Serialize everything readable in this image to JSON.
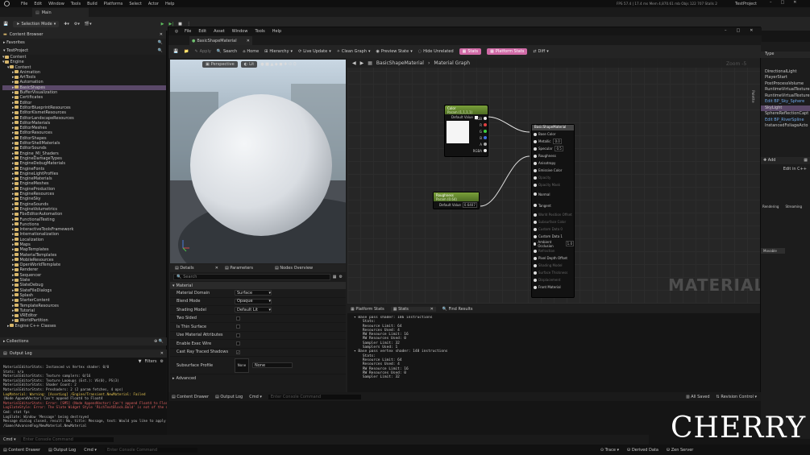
{
  "top": {
    "menu": [
      "File",
      "Edit",
      "Window",
      "Tools",
      "Build",
      "Platforms",
      "Select",
      "Actor",
      "Help"
    ],
    "stats": "FPS 57.4 | 17.4 ms  Mem 4,870.61 mb  Objs 122 707  Stalls 2",
    "project": "TestProject",
    "map_tab": "Main",
    "selection_mode": "Selection Mode"
  },
  "cb": {
    "title": "Content Browser",
    "favorites": "Favorites",
    "project": "TestProject",
    "items": [
      "Content",
      "Engine",
      "Content",
      "Animation",
      "ArtTools",
      "Automation",
      "BasicShapes",
      "BufferVisualization",
      "Certificates",
      "Editor",
      "EditorBlueprintResources",
      "EditorKismetResources",
      "EditorLandscapeResources",
      "EditorMaterials",
      "EditorMeshes",
      "EditorResources",
      "EditorShapes",
      "EditorShellMaterials",
      "EditorSounds",
      "Engine_MI_Shaders",
      "EngineDamageTypes",
      "EngineDebugMaterials",
      "EngineFonts",
      "EngineLightProfiles",
      "EngineMaterials",
      "EngineMeshes",
      "EngineProduction",
      "EngineResources",
      "EngineSky",
      "EngineSounds",
      "EngineVolumetrics",
      "FbxEditorAutomation",
      "FunctionalTesting",
      "Functions",
      "InteractiveToolsFramework",
      "Internationalization",
      "Localization",
      "Maps",
      "MapTemplates",
      "MaterialTemplates",
      "MobileResources",
      "OpenWorldTemplate",
      "Renderer",
      "Sequencer",
      "Slate",
      "SlateDebug",
      "SlateFileDialogs",
      "Splash",
      "StarterContent",
      "TemplateResources",
      "Tutorial",
      "VREditor",
      "WorldPartition",
      "Engine C++ Classes"
    ],
    "collections": "Collections"
  },
  "ol": {
    "title": "Output Log",
    "filters": "Filters",
    "lines": [
      "MaterialEditorStats: Instanced vs Vertex shader: 0/0",
      "Stats: n/a",
      "MaterialEditorStats: Texture samplers: 0/16",
      "MaterialEditorStats: Texture Lookups (Est.): VS(0), PS(3)",
      "MaterialEditorStats: Shader Count: 2",
      "MaterialEditorStats: Preshaders: 2  (2 param fetches, 4 ops)",
      "LogMaterial: Warning: [AssetLog] /Engine/Transient.NewMaterial: Failed",
      "  (Node AppendVector) Can't append Float4 to Float4",
      "MaterialEditorStats: Error: [SM5] (Node AppendVector) Can't append Float4 to Float4",
      "LogSlateStyle: Error: The Slate Widget Style 'RichTextBlock.Bold' is not of the desired type. Desired: 'FEditableTextStyle', Actual: 'FTextBlockStyle'",
      "Cmd: stat fps",
      "LogSlate: Window 'Message' being destroyed",
      "Message dialog closed, result: No, title: Message, text: Would you like to apply the changes of the modified material to the original material?",
      "/Game/AdvancedFog/NewMaterial.NewMaterial"
    ],
    "cmd": "Cmd",
    "cmd_placeholder": "Enter Console Command"
  },
  "mw": {
    "menu": [
      "File",
      "Edit",
      "Asset",
      "Window",
      "Tools",
      "Help"
    ],
    "tab": "BasicShapeMaterial",
    "toolbar": [
      "Save",
      "Browse",
      "Apply",
      "Search",
      "Home",
      "Hierarchy",
      "Live Update",
      "Clean Graph",
      "Preview State",
      "Hide Unrelated",
      "Stats",
      "Platform Stats",
      "Diff"
    ],
    "viewport": {
      "perspective": "Perspective",
      "lit": "Lit"
    },
    "details_tabs": [
      "Details",
      "Parameters",
      "Nodes Overview"
    ],
    "search_placeholder": "Search",
    "section": "Material",
    "props": [
      {
        "k": "Material Domain",
        "v": "Surface"
      },
      {
        "k": "Blend Mode",
        "v": "Opaque"
      },
      {
        "k": "Shading Model",
        "v": "Default Lit"
      },
      {
        "k": "Two Sided",
        "v": ""
      },
      {
        "k": "Is Thin Surface",
        "v": ""
      },
      {
        "k": "Use Material Attributes",
        "v": ""
      },
      {
        "k": "Enable Exec Wire",
        "v": ""
      },
      {
        "k": "Cast Ray Traced Shadows",
        "v": "checked"
      },
      {
        "k": "Subsurface Profile",
        "v": "None"
      }
    ],
    "advanced": "Advanced",
    "breadcrumb": [
      "BasicShapeMaterial",
      "Material Graph"
    ],
    "zoom": "Zoom -5",
    "palette": "Palette",
    "watermark": "MATERIAL",
    "color_node": {
      "title": "Color",
      "sub": "Param (1,1,1,1)",
      "default": "Default Value",
      "pins": [
        "RGB",
        "R",
        "G",
        "B",
        "A",
        "RGBA"
      ]
    },
    "rough_node": {
      "title": "Roughness",
      "sub": "Param (0.64)",
      "default": "Default Value",
      "value": "0.6407"
    },
    "mat_node": {
      "title": "BasicShapeMaterial",
      "pins": [
        "Base Color",
        "Metallic",
        "Specular",
        "Roughness",
        "Anisotropy",
        "Emissive Color",
        "Opacity",
        "Opacity Mask",
        "Normal",
        "Tangent",
        "World Position Offset",
        "Subsurface Color",
        "Custom Data 0",
        "Custom Data 1",
        "Ambient Occlusion",
        "Refraction",
        "Pixel Depth Offset",
        "Shading Model",
        "Surface Thickness",
        "Displacement",
        "Front Material"
      ],
      "metallic": "0.0",
      "specular": "0.5",
      "ao": "1.0"
    },
    "stats_tabs": [
      "Platform Stats",
      "Stats",
      "Find Results"
    ],
    "stats_text": "▾ Base pass shader: 186 instructions\n    Stats:\n    Resource Limit: 64\n    Resources Used: 4\n    RW Resource Limit: 16\n    RW Resources Used: 0\n    Sampler Limit: 32\n    Samplers Used: 1\n▾ Base pass vertex shader: 148 instructions\n    Stats:\n    Resource Limit: 64\n    Resources Used: 4\n    RW Resource Limit: 16\n    RW Resources Used: 0\n    Sampler Limit: 32",
    "bottom": {
      "drawer": "Content Drawer",
      "log": "Output Log",
      "cmd": "Cmd",
      "placeholder": "Enter Console Command",
      "saved": "All Saved",
      "rev": "Revision Control"
    }
  },
  "right": {
    "type": "Type",
    "items": [
      "DirectionalLight",
      "PlayerStart",
      "PostProcessVolume",
      "RuntimeVirtualTexture",
      "RuntimeVirtualTexture",
      "Edit BP_Sky_Sphere",
      "SkyLight",
      "SphereReflectionCapt",
      "Edit BP_RiverSpline",
      "InstancedFoliageActo"
    ],
    "add": "Add",
    "edit_cpp": "Edit in C++",
    "rendering": "Rendering",
    "streaming": "Streaming",
    "movable": "Movable"
  },
  "bottom": {
    "drawer": "Content Drawer",
    "log": "Output Log",
    "cmd": "Cmd",
    "placeholder": "Enter Console Command",
    "trace": "Trace",
    "derived": "Derived Data",
    "zen": "Zen Server",
    "saved": "All Saved",
    "rev": "Revision Control"
  },
  "logo": "CHERRY"
}
